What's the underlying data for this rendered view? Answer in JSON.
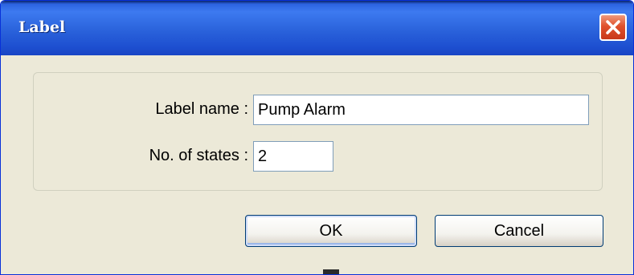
{
  "window": {
    "title": "Label"
  },
  "form": {
    "label_name": {
      "label": "Label name :",
      "value": "Pump Alarm"
    },
    "num_states": {
      "label": "No. of states :",
      "value": "2"
    }
  },
  "buttons": {
    "ok_label": "OK",
    "cancel_label": "Cancel"
  },
  "icons": {
    "close": "close-icon"
  },
  "colors": {
    "title_bar": "#2a62db",
    "close_button": "#e0512c",
    "dialog_background": "#ece9d8",
    "input_border": "#7f9db9"
  }
}
